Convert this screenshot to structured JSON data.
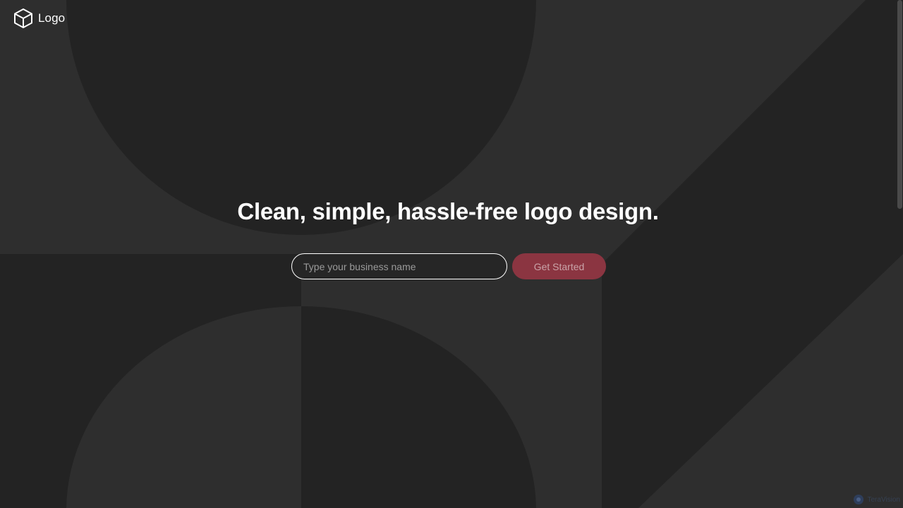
{
  "brand": {
    "logo_label": "Logo",
    "logo_icon": "cube-icon"
  },
  "hero": {
    "headline": "Clean, simple, hassle-free logo design.",
    "input_placeholder": "Type your business name",
    "input_value": "",
    "button_label": "Get Started"
  },
  "badge": {
    "icon": "badge-icon",
    "text": "TeraVision"
  },
  "colors": {
    "background": "#2e2e2e",
    "shape_dark": "#232323",
    "accent": "#8b3541",
    "text": "#ffffff"
  }
}
